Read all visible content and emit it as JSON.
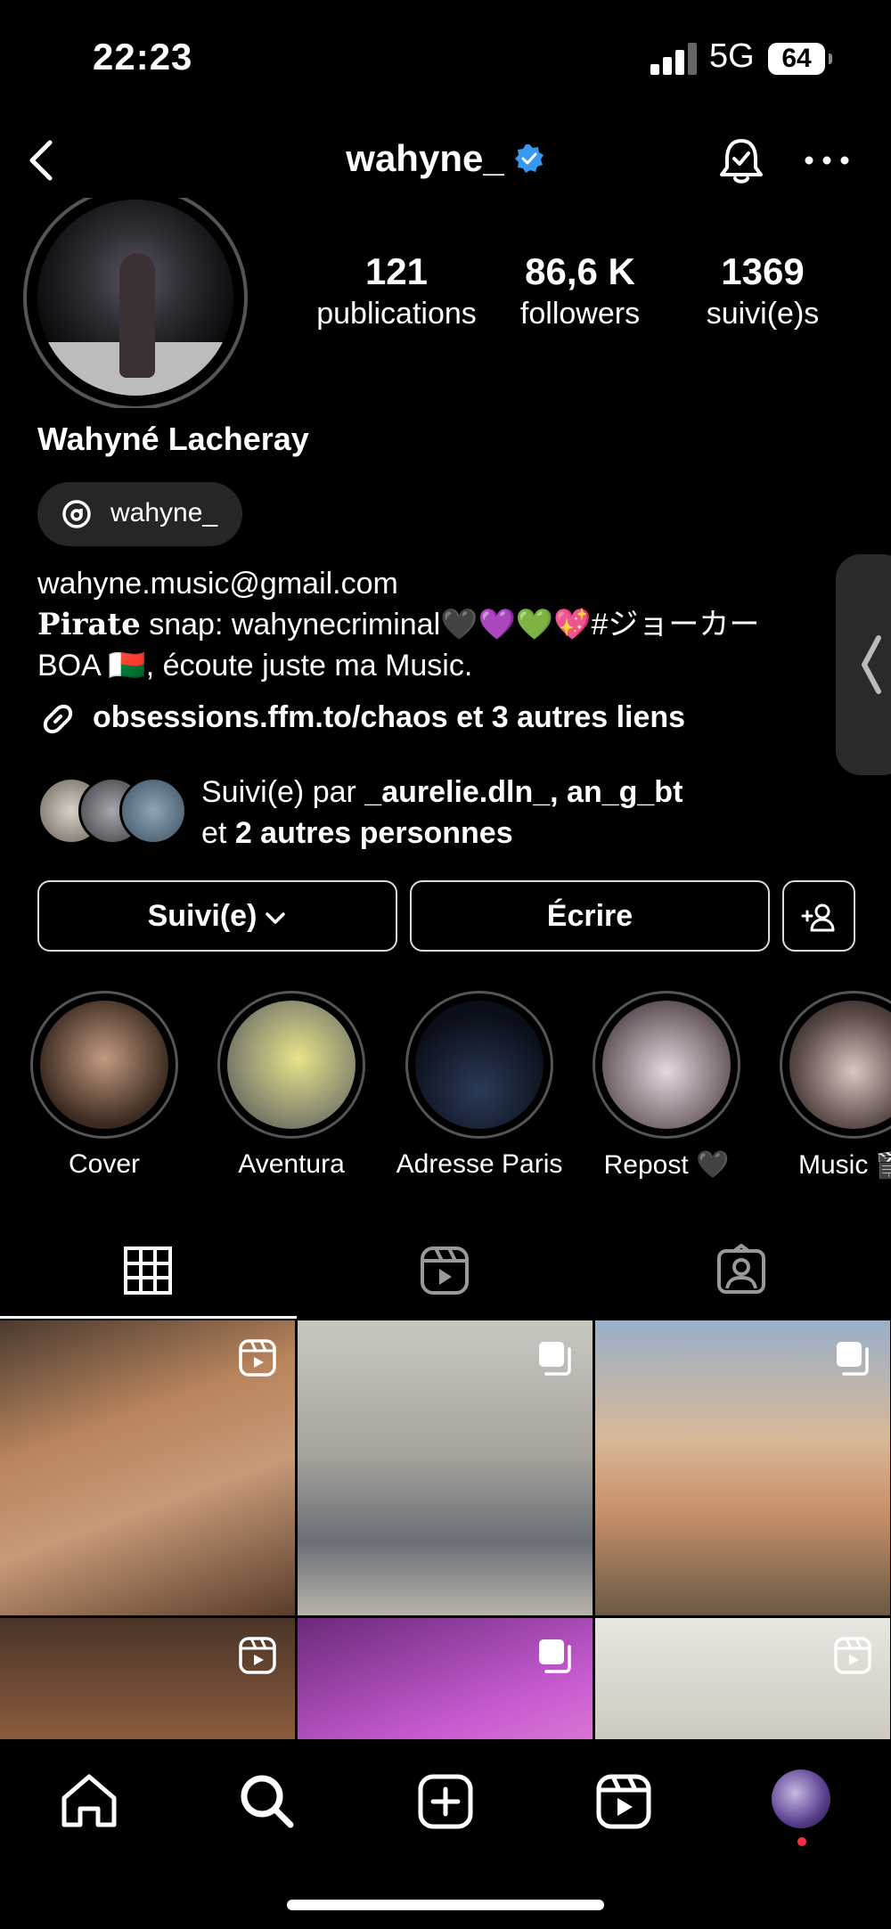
{
  "status": {
    "time": "22:23",
    "network": "5G",
    "battery": "64"
  },
  "header": {
    "username": "wahyne_"
  },
  "stats": [
    {
      "value": "121",
      "label": "publications"
    },
    {
      "value": "86,6 K",
      "label": "followers"
    },
    {
      "value": "1369",
      "label": "suivi(e)s"
    }
  ],
  "profile": {
    "full_name": "Wahyné Lacheray",
    "threads_handle": "wahyne_",
    "bio_line1": "wahyne.music@gmail.com",
    "bio_pirate": "Pirate",
    "bio_line2_rest": " snap: wahynecriminal🖤💜💚💖#ジョーカー",
    "bio_line3": "BOA 🇲🇬, écoute juste ma Music.",
    "link_text": "obsessions.ffm.to/chaos et 3 autres liens"
  },
  "followed_by": {
    "prefix": "Suivi(e) par ",
    "users": "_aurelie.dln_, an_g_bt",
    "line2_prefix": "et ",
    "line2_bold": "2 autres personnes"
  },
  "actions": {
    "follow_label": "Suivi(e)",
    "write_label": "Écrire"
  },
  "highlights": [
    {
      "label": "Cover"
    },
    {
      "label": "Aventura"
    },
    {
      "label": "Adresse Paris"
    },
    {
      "label": "Repost 🖤"
    },
    {
      "label": "Music 🎬"
    }
  ],
  "tabs": [
    {
      "icon": "grid-icon"
    },
    {
      "icon": "reels-icon"
    },
    {
      "icon": "tagged-icon"
    }
  ],
  "posts": [
    {
      "type": "reel",
      "color": "#8a5a3c"
    },
    {
      "type": "carousel",
      "color": "#b9b8b2"
    },
    {
      "type": "carousel",
      "color": "#b88c6e"
    },
    {
      "type": "reel",
      "color": "#6e4a36"
    },
    {
      "type": "carousel",
      "color": "#a24fb0"
    },
    {
      "type": "reel",
      "color": "#d9d6cf"
    }
  ]
}
